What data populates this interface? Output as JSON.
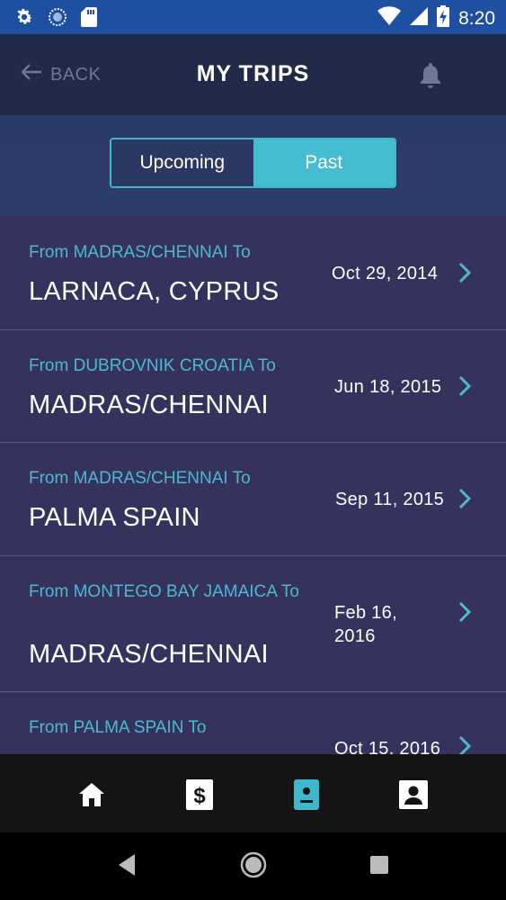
{
  "status_bar": {
    "time": "8:20",
    "icons": [
      "settings-icon",
      "sync-icon",
      "sd-card-icon",
      "wifi-icon",
      "cell-signal-icon",
      "battery-charging-icon"
    ]
  },
  "header": {
    "back_label": "BACK",
    "title": "MY TRIPS",
    "bell_icon": "bell-icon"
  },
  "tabs": {
    "upcoming": "Upcoming",
    "past": "Past",
    "selected": "Past"
  },
  "trips": [
    {
      "from": "From MADRAS/CHENNAI To",
      "to": "LARNACA, CYPRUS",
      "date": "Oct 29, 2014"
    },
    {
      "from": "From DUBROVNIK CROATIA To",
      "to": "MADRAS/CHENNAI",
      "date": "Jun 18, 2015"
    },
    {
      "from": "From MADRAS/CHENNAI To",
      "to": "PALMA SPAIN",
      "date": "Sep 11, 2015"
    },
    {
      "from": "From MONTEGO BAY JAMAICA To",
      "to": "MADRAS/CHENNAI",
      "date": "Feb 16, 2016"
    },
    {
      "from": "From PALMA SPAIN To",
      "to": "",
      "date": "Oct 15, 2016"
    }
  ],
  "bottom_nav": [
    "home-icon",
    "dollar-icon",
    "trips-icon",
    "profile-icon"
  ],
  "colors": {
    "accent": "#45bccf",
    "header": "#222a4a",
    "list_bg": "#35335e",
    "from_text": "#4db8d0"
  }
}
